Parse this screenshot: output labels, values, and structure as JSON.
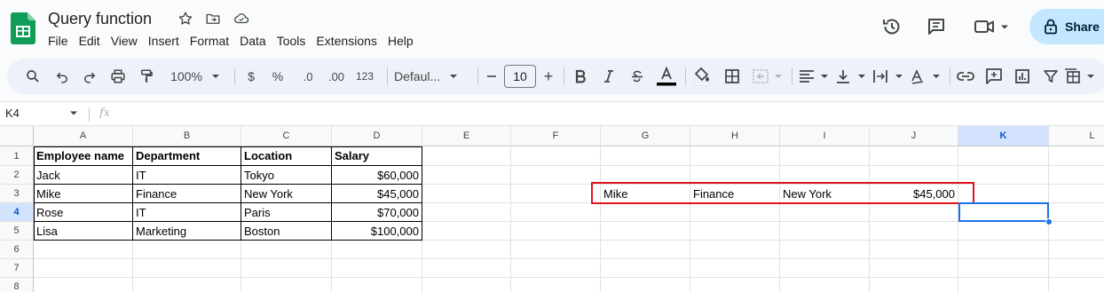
{
  "document": {
    "title": "Query function"
  },
  "menu": [
    "File",
    "Edit",
    "View",
    "Insert",
    "Format",
    "Data",
    "Tools",
    "Extensions",
    "Help"
  ],
  "share": {
    "label": "Share"
  },
  "toolbar": {
    "zoom": "100%",
    "currency": "$",
    "percent": "%",
    "decrease_decimal": ".0",
    "increase_decimal": ".00",
    "number_format": "123",
    "font": "Defaul...",
    "font_size": "10",
    "minus": "—",
    "plus": "+"
  },
  "formula_bar": {
    "cell_ref": "K4",
    "fx": "fx"
  },
  "columns": [
    "A",
    "B",
    "C",
    "D",
    "E",
    "F",
    "G",
    "H",
    "I",
    "J",
    "K",
    "L"
  ],
  "rows": [
    "1",
    "2",
    "3",
    "4",
    "5",
    "6",
    "7",
    "8"
  ],
  "active_cell": {
    "column": "K",
    "row": "4"
  },
  "table": {
    "headers": [
      "Employee name",
      "Department",
      "Location",
      "Salary"
    ],
    "data": [
      [
        "Jack",
        "IT",
        "Tokyo",
        "$60,000"
      ],
      [
        "Mike",
        "Finance",
        "New York",
        "$45,000"
      ],
      [
        "Rose",
        "IT",
        "Paris",
        "$70,000"
      ],
      [
        "Lisa",
        "Marketing",
        "Boston",
        "$100,000"
      ]
    ]
  },
  "query_result": [
    "Mike",
    "Finance",
    "New York",
    "$45,000"
  ],
  "colors": {
    "accent": "#1a73e8",
    "highlight": "#e0141e",
    "share_bg": "#c2e7ff",
    "sheets_green": "#0f9d58"
  }
}
